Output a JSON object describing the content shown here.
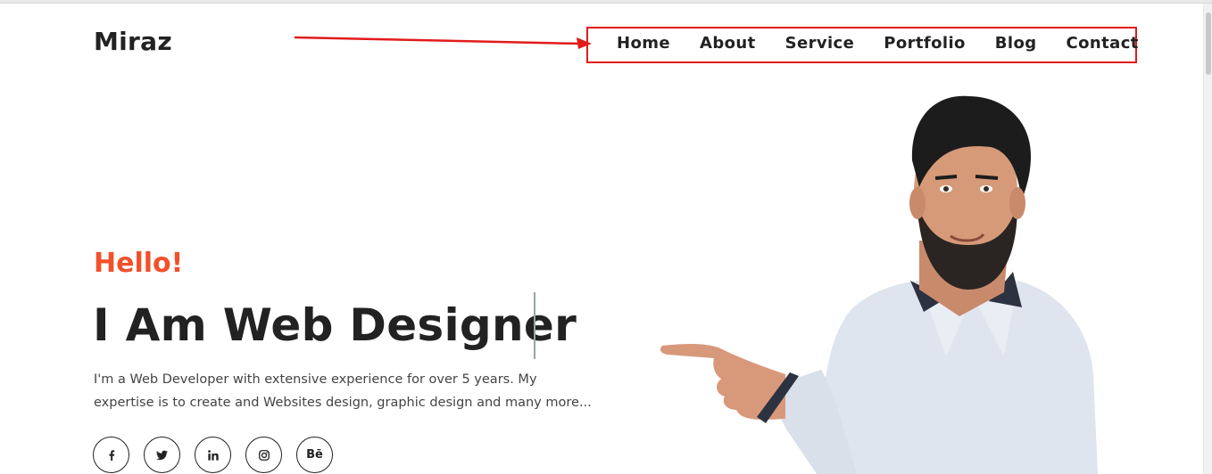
{
  "header": {
    "logo": "Miraz",
    "nav": [
      {
        "label": "Home"
      },
      {
        "label": "About"
      },
      {
        "label": "Service"
      },
      {
        "label": "Portfolio"
      },
      {
        "label": "Blog"
      },
      {
        "label": "Contact"
      }
    ],
    "annotation_color": "#e21b1b"
  },
  "hero": {
    "greeting": "Hello!",
    "greeting_color": "#f2502a",
    "headline": "I Am Web Designer",
    "description": "I'm a Web Developer with extensive experience for over 5 years. My expertise is to create and Websites design, graphic design and many more...",
    "socials": [
      {
        "icon": "facebook-icon",
        "glyph": "f"
      },
      {
        "icon": "twitter-icon",
        "glyph": "t"
      },
      {
        "icon": "linkedin-icon",
        "glyph": "in"
      },
      {
        "icon": "instagram-icon",
        "glyph": "ig"
      },
      {
        "icon": "behance-icon",
        "glyph": "Bē"
      }
    ]
  }
}
